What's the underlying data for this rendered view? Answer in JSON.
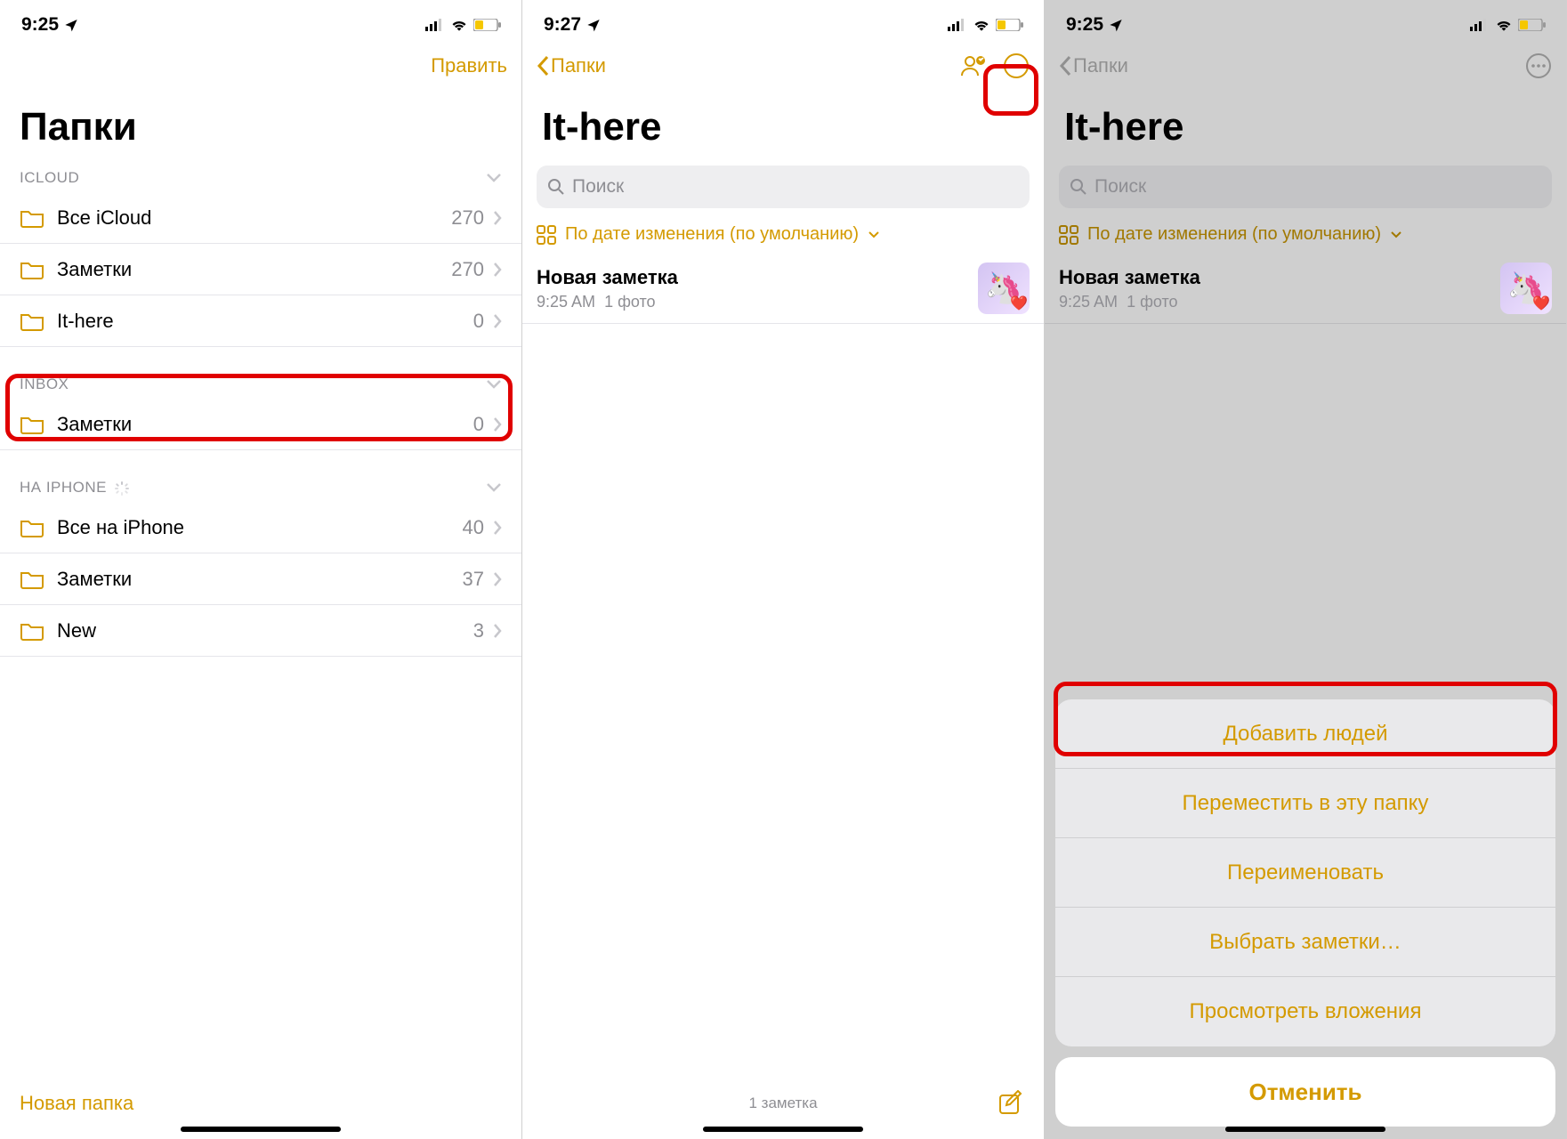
{
  "status": {
    "time1": "9:25",
    "time2": "9:27",
    "time3": "9:25"
  },
  "screen1": {
    "editBtn": "Править",
    "title": "Папки",
    "sections": [
      {
        "name": "ICLOUD",
        "items": [
          {
            "label": "Все iCloud",
            "count": "270"
          },
          {
            "label": "Заметки",
            "count": "270"
          },
          {
            "label": "It-here",
            "count": "0"
          }
        ]
      },
      {
        "name": "INBOX",
        "items": [
          {
            "label": "Заметки",
            "count": "0"
          }
        ]
      },
      {
        "name": "НА IPHONE",
        "spinner": true,
        "items": [
          {
            "label": "Все на iPhone",
            "count": "40"
          },
          {
            "label": "Заметки",
            "count": "37"
          },
          {
            "label": "New",
            "count": "3"
          }
        ]
      }
    ],
    "newFolder": "Новая папка"
  },
  "screen2": {
    "back": "Папки",
    "title": "It-here",
    "searchPlaceholder": "Поиск",
    "sortLabel": "По дате изменения (по умолчанию)",
    "note": {
      "title": "Новая заметка",
      "time": "9:25 AM",
      "meta": "1 фото"
    },
    "footerCount": "1 заметка"
  },
  "screen3": {
    "back": "Папки",
    "title": "It-here",
    "searchPlaceholder": "Поиск",
    "sortLabel": "По дате изменения (по умолчанию)",
    "note": {
      "title": "Новая заметка",
      "time": "9:25 AM",
      "meta": "1 фото"
    },
    "sheet": {
      "options": [
        "Добавить людей",
        "Переместить в эту папку",
        "Переименовать",
        "Выбрать заметки…",
        "Просмотреть вложения"
      ],
      "cancel": "Отменить"
    }
  }
}
